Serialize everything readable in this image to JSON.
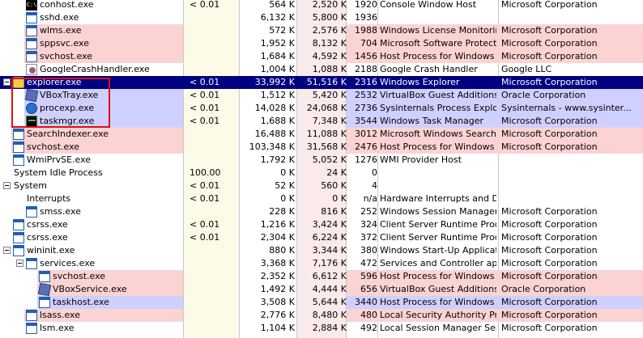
{
  "colors": {
    "pink": "#fcd3d3",
    "blue": "#d0d0ff",
    "selected": "#000080",
    "cpu_column": "#fbfbe8",
    "ws_column": "#fbeaea",
    "annotation_box": "#e01010"
  },
  "processes": [
    {
      "name": "conhost.exe",
      "cpu": "< 0.01",
      "private": "564 K",
      "working_set": "2,520 K",
      "pid": "1920",
      "description": "Console Window Host",
      "company": "Microsoft Corporation",
      "icon": "console-icon",
      "tree": "",
      "tint": "none"
    },
    {
      "name": "sshd.exe",
      "cpu": "",
      "private": "6,132 K",
      "working_set": "5,800 K",
      "pid": "1936",
      "description": "",
      "company": "",
      "icon": "application-icon",
      "tree": "",
      "tint": "none"
    },
    {
      "name": "wlms.exe",
      "cpu": "",
      "private": "572 K",
      "working_set": "2,576 K",
      "pid": "1988",
      "description": "Windows License Monitoring...",
      "company": "Microsoft Corporation",
      "icon": "application-icon",
      "tree": "",
      "tint": "pink"
    },
    {
      "name": "sppsvc.exe",
      "cpu": "",
      "private": "1,952 K",
      "working_set": "8,132 K",
      "pid": "704",
      "description": "Microsoft Software Protectio...",
      "company": "Microsoft Corporation",
      "icon": "application-icon",
      "tree": "",
      "tint": "pink"
    },
    {
      "name": "svchost.exe",
      "cpu": "",
      "private": "1,684 K",
      "working_set": "4,592 K",
      "pid": "1456",
      "description": "Host Process for Windows S...",
      "company": "Microsoft Corporation",
      "icon": "application-icon",
      "tree": "",
      "tint": "pink"
    },
    {
      "name": "GoogleCrashHandler.exe",
      "cpu": "",
      "private": "1,004 K",
      "working_set": "1,088 K",
      "pid": "2188",
      "description": "Google Crash Handler",
      "company": "Google LLC",
      "icon": "google-icon",
      "tree": "",
      "tint": "none"
    },
    {
      "name": "explorer.exe",
      "cpu": "< 0.01",
      "private": "33,992 K",
      "working_set": "51,516 K",
      "pid": "2316",
      "description": "Windows Explorer",
      "company": "Microsoft Corporation",
      "icon": "folder-icon",
      "tree": "collapse",
      "tint": "selected"
    },
    {
      "name": "VBoxTray.exe",
      "cpu": "< 0.01",
      "private": "1,512 K",
      "working_set": "5,420 K",
      "pid": "2532",
      "description": "VirtualBox Guest Additions Tr...",
      "company": "Oracle Corporation",
      "icon": "virtualbox-icon",
      "tree": "",
      "tint": "blue"
    },
    {
      "name": "procexp.exe",
      "cpu": "< 0.01",
      "private": "14,028 K",
      "working_set": "24,068 K",
      "pid": "2736",
      "description": "Sysinternals Process Explorer",
      "company": "Sysinternals - www.sysinter...",
      "icon": "process-explorer-icon",
      "tree": "",
      "tint": "blue"
    },
    {
      "name": "taskmgr.exe",
      "cpu": "< 0.01",
      "private": "1,688 K",
      "working_set": "7,348 K",
      "pid": "3544",
      "description": "Windows Task Manager",
      "company": "Microsoft Corporation",
      "icon": "task-manager-icon",
      "tree": "",
      "tint": "blue"
    },
    {
      "name": "SearchIndexer.exe",
      "cpu": "",
      "private": "16,488 K",
      "working_set": "11,088 K",
      "pid": "3012",
      "description": "Microsoft Windows Search I...",
      "company": "Microsoft Corporation",
      "icon": "application-icon",
      "tree": "",
      "tint": "pink"
    },
    {
      "name": "svchost.exe",
      "cpu": "",
      "private": "103,348 K",
      "working_set": "31,568 K",
      "pid": "2476",
      "description": "Host Process for Windows S...",
      "company": "Microsoft Corporation",
      "icon": "application-icon",
      "tree": "",
      "tint": "pink"
    },
    {
      "name": "WmiPrvSE.exe",
      "cpu": "",
      "private": "1,792 K",
      "working_set": "5,052 K",
      "pid": "1276",
      "description": "WMI Provider Host",
      "company": "",
      "icon": "application-icon",
      "tree": "",
      "tint": "none"
    },
    {
      "name": "System Idle Process",
      "cpu": "100.00",
      "private": "0 K",
      "working_set": "24 K",
      "pid": "0",
      "description": "",
      "company": "",
      "icon": "",
      "tree": "",
      "tint": "none"
    },
    {
      "name": "System",
      "cpu": "< 0.01",
      "private": "52 K",
      "working_set": "560 K",
      "pid": "4",
      "description": "",
      "company": "",
      "icon": "",
      "tree": "collapse",
      "tint": "none"
    },
    {
      "name": "Interrupts",
      "cpu": "< 0.01",
      "private": "0 K",
      "working_set": "0 K",
      "pid": "n/a",
      "description": "Hardware Interrupts and DPCs",
      "company": "",
      "icon": "",
      "tree": "",
      "tint": "none"
    },
    {
      "name": "smss.exe",
      "cpu": "",
      "private": "228 K",
      "working_set": "816 K",
      "pid": "252",
      "description": "Windows Session Manager",
      "company": "Microsoft Corporation",
      "icon": "application-icon",
      "tree": "",
      "tint": "none"
    },
    {
      "name": "csrss.exe",
      "cpu": "< 0.01",
      "private": "1,216 K",
      "working_set": "3,424 K",
      "pid": "324",
      "description": "Client Server Runtime Process",
      "company": "Microsoft Corporation",
      "icon": "application-icon",
      "tree": "",
      "tint": "none"
    },
    {
      "name": "csrss.exe",
      "cpu": "< 0.01",
      "private": "2,304 K",
      "working_set": "6,224 K",
      "pid": "372",
      "description": "Client Server Runtime Process",
      "company": "Microsoft Corporation",
      "icon": "application-icon",
      "tree": "",
      "tint": "none"
    },
    {
      "name": "wininit.exe",
      "cpu": "",
      "private": "880 K",
      "working_set": "3,344 K",
      "pid": "380",
      "description": "Windows Start-Up Application",
      "company": "Microsoft Corporation",
      "icon": "application-icon",
      "tree": "collapse",
      "tint": "none"
    },
    {
      "name": "services.exe",
      "cpu": "",
      "private": "3,368 K",
      "working_set": "7,176 K",
      "pid": "472",
      "description": "Services and Controller app",
      "company": "Microsoft Corporation",
      "icon": "application-icon",
      "tree": "collapse",
      "tint": "none"
    },
    {
      "name": "svchost.exe",
      "cpu": "",
      "private": "2,352 K",
      "working_set": "6,612 K",
      "pid": "596",
      "description": "Host Process for Windows S...",
      "company": "Microsoft Corporation",
      "icon": "application-icon",
      "tree": "",
      "tint": "pink"
    },
    {
      "name": "VBoxService.exe",
      "cpu": "",
      "private": "1,492 K",
      "working_set": "4,444 K",
      "pid": "656",
      "description": "VirtualBox Guest Additions S...",
      "company": "Oracle Corporation",
      "icon": "virtualbox-icon",
      "tree": "",
      "tint": "pink"
    },
    {
      "name": "taskhost.exe",
      "cpu": "",
      "private": "3,508 K",
      "working_set": "5,644 K",
      "pid": "3440",
      "description": "Host Process for Windows T...",
      "company": "Microsoft Corporation",
      "icon": "application-icon",
      "tree": "",
      "tint": "blue"
    },
    {
      "name": "lsass.exe",
      "cpu": "",
      "private": "2,776 K",
      "working_set": "8,480 K",
      "pid": "480",
      "description": "Local Security Authority Proc...",
      "company": "Microsoft Corporation",
      "icon": "application-icon",
      "tree": "",
      "tint": "pink"
    },
    {
      "name": "lsm.exe",
      "cpu": "",
      "private": "1,104 K",
      "working_set": "2,884 K",
      "pid": "492",
      "description": "Local Session Manager Serv...",
      "company": "Microsoft Corporation",
      "icon": "application-icon",
      "tree": "",
      "tint": "none"
    }
  ]
}
